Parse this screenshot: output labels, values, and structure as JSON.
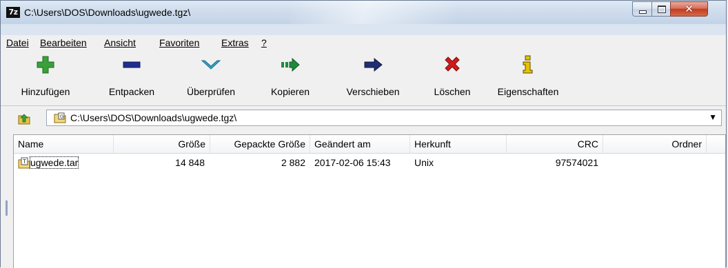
{
  "window": {
    "title": "C:\\Users\\DOS\\Downloads\\ugwede.tgz\\",
    "app_icon_label": "7z",
    "controls": [
      "minimize-icon",
      "maximize-icon",
      "close-icon"
    ]
  },
  "menu": {
    "items": [
      "Datei",
      "Bearbeiten",
      "Ansicht",
      "Favoriten",
      "Extras",
      "?"
    ]
  },
  "toolbar": {
    "buttons": [
      {
        "label": "Hinzufügen",
        "icon": "plus-icon",
        "color": "#3aa03a"
      },
      {
        "label": "Entpacken",
        "icon": "minus-icon",
        "color": "#1f2f8f"
      },
      {
        "label": "Überprüfen",
        "icon": "check-chevron-icon",
        "color": "#2fa6c9"
      },
      {
        "label": "Kopieren",
        "icon": "copy-arrow-icon",
        "color": "#1f8a3a"
      },
      {
        "label": "Verschieben",
        "icon": "move-arrow-icon",
        "color": "#1f2f6f"
      },
      {
        "label": "Löschen",
        "icon": "delete-x-icon",
        "color": "#d11a1a"
      },
      {
        "label": "Eigenschaften",
        "icon": "info-icon",
        "color": "#b89a00"
      }
    ]
  },
  "address": {
    "path": "C:\\Users\\DOS\\Downloads\\ugwede.tgz\\"
  },
  "list": {
    "columns": [
      "Name",
      "Größe",
      "Gepackte Größe",
      "Geändert am",
      "Herkunft",
      "CRC",
      "Ordner"
    ],
    "rows": [
      {
        "name": "ugwede.tar",
        "size": "14 848",
        "packed": "2 882",
        "modified": "2017-02-06 15:43",
        "origin": "Unix",
        "crc": "97574021",
        "folders": ""
      }
    ]
  }
}
